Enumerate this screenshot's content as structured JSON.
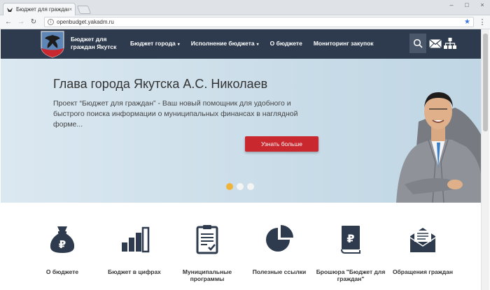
{
  "browser": {
    "tab_title": "Бюджет для граждан",
    "tab_close": "×",
    "url": "openbudget.yakadm.ru",
    "window_controls": [
      "–",
      "□",
      "×"
    ]
  },
  "header": {
    "brand_line1": "Бюджет для",
    "brand_line2": "граждан Якутск",
    "nav": [
      {
        "label": "Бюджет города",
        "caret": "▾"
      },
      {
        "label": "Исполнение бюджета",
        "caret": "▾"
      },
      {
        "label": "О бюджете",
        "caret": ""
      },
      {
        "label": "Мониторинг закупок",
        "caret": ""
      }
    ],
    "icons": [
      "search-icon",
      "mail-icon",
      "sitemap-icon"
    ]
  },
  "hero": {
    "title": "Глава города Якутска А.С. Николаев",
    "text": "Проект “Бюджет для граждан” - Ваш новый помощник для удобного и быстрого поиска информации о муниципальных финансах в наглядной форме...",
    "button": "Узнать больше",
    "slides": 3,
    "active_slide": 1
  },
  "features": [
    {
      "label": "О бюджете",
      "icon": "money-bag-icon"
    },
    {
      "label": "Бюджет в цифрах",
      "icon": "bar-chart-icon"
    },
    {
      "label": "Муниципальные программы",
      "icon": "clipboard-icon"
    },
    {
      "label": "Полезные ссылки",
      "icon": "pie-chart-icon"
    },
    {
      "label": "Брошюра \"Бюджет для граждан\"",
      "icon": "brochure-icon"
    },
    {
      "label": "Обращения граждан",
      "icon": "envelope-icon"
    }
  ],
  "colors": {
    "header_bg": "#2e3b4e",
    "accent_button": "#c8282e",
    "active_dot": "#f0b43a",
    "icon_dark": "#2e3b4e"
  }
}
